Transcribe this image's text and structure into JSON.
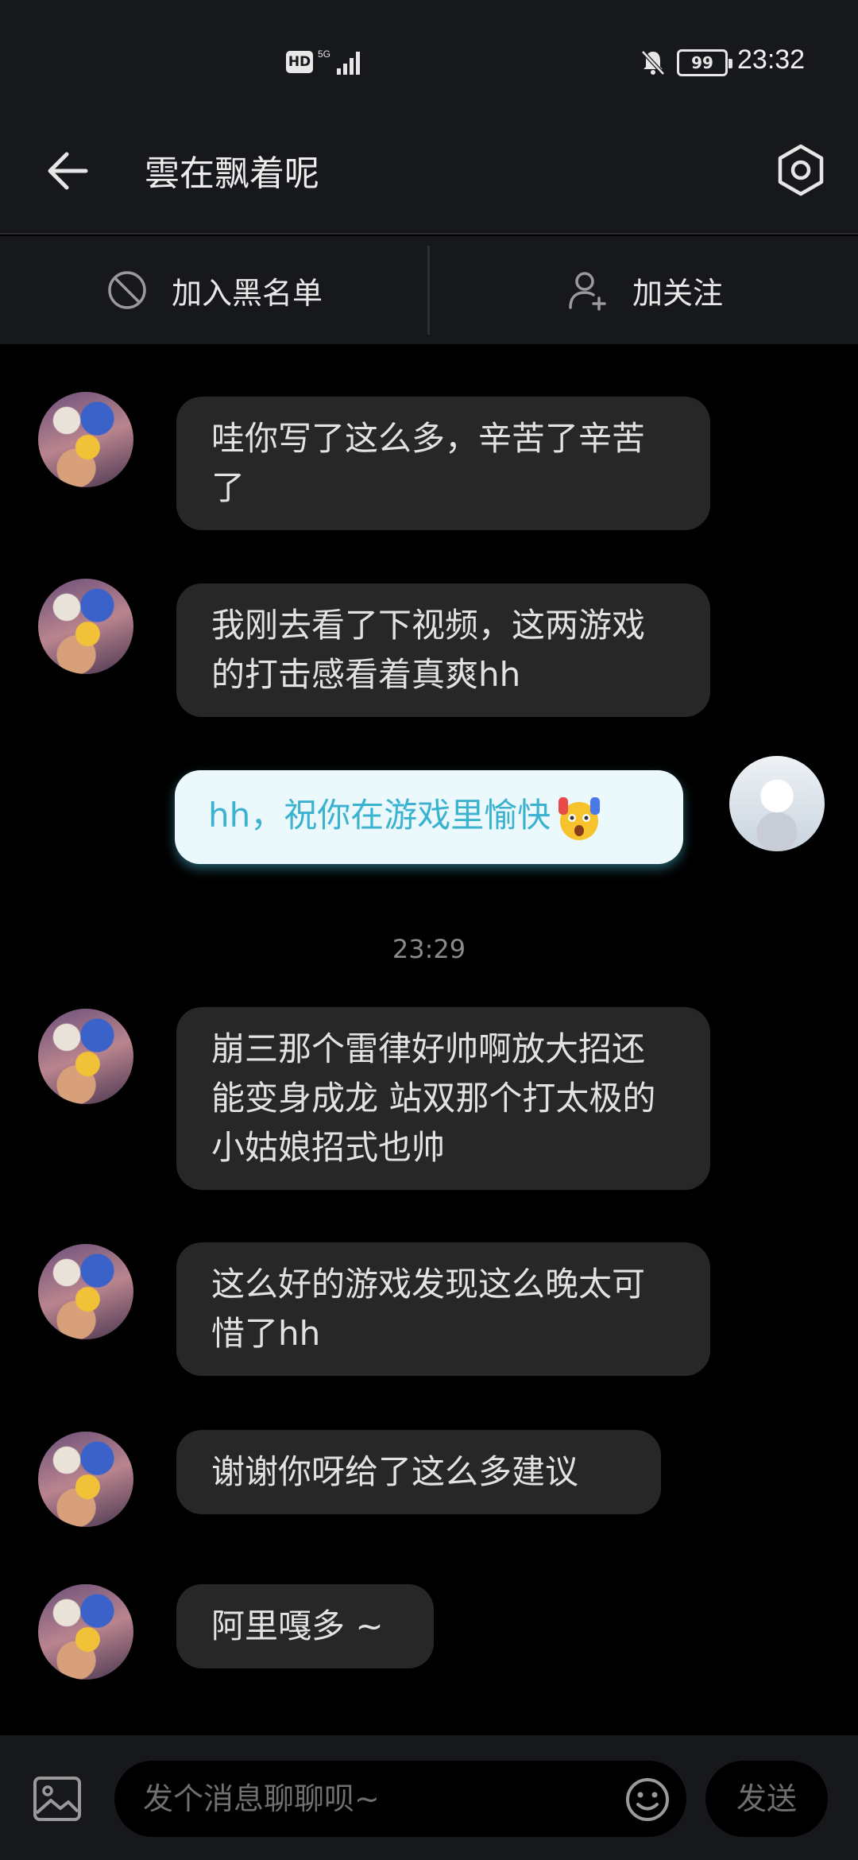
{
  "status_bar": {
    "hd_label": "HD",
    "network_label": "5G",
    "battery_level": "99",
    "time": "23:32",
    "icons": [
      "hd-icon",
      "signal-icon",
      "mute-bell-icon",
      "battery-icon"
    ]
  },
  "header": {
    "title": "雲在飘着呢",
    "back_icon": "arrow-left-icon",
    "settings_icon": "settings-hexagon-icon"
  },
  "actions": {
    "block_label": "加入黑名单",
    "block_icon": "block-icon",
    "follow_label": "加关注",
    "follow_icon": "add-user-icon"
  },
  "messages": [
    {
      "sender": "other",
      "text": "哇你写了这么多，辛苦了辛苦了"
    },
    {
      "sender": "other",
      "text": "我刚去看了下视频，这两游戏的打击感看着真爽hh"
    },
    {
      "sender": "me",
      "text": "hh，祝你在游戏里愉快",
      "emoji": "shocked-face-emoji"
    },
    {
      "sender": "other",
      "text": "崩三那个雷律好帅啊放大招还能变身成龙 站双那个打太极的小姑娘招式也帅"
    },
    {
      "sender": "other",
      "text": "这么好的游戏发现这么晚太可惜了hh"
    },
    {
      "sender": "other",
      "text": "谢谢你呀给了这么多建议"
    },
    {
      "sender": "other",
      "text": "阿里嘎多 ~"
    }
  ],
  "timestamp": "23:29",
  "input_bar": {
    "placeholder": "发个消息聊聊呗~",
    "value": "",
    "send_label": "发送",
    "image_icon": "image-icon",
    "emoji_icon": "smiley-icon"
  },
  "colors": {
    "background": "#000000",
    "bar": "#17181b",
    "bubble_other": "#272727",
    "bubble_mine": "#ecf9fc",
    "bubble_mine_text": "#3bb2d0"
  }
}
